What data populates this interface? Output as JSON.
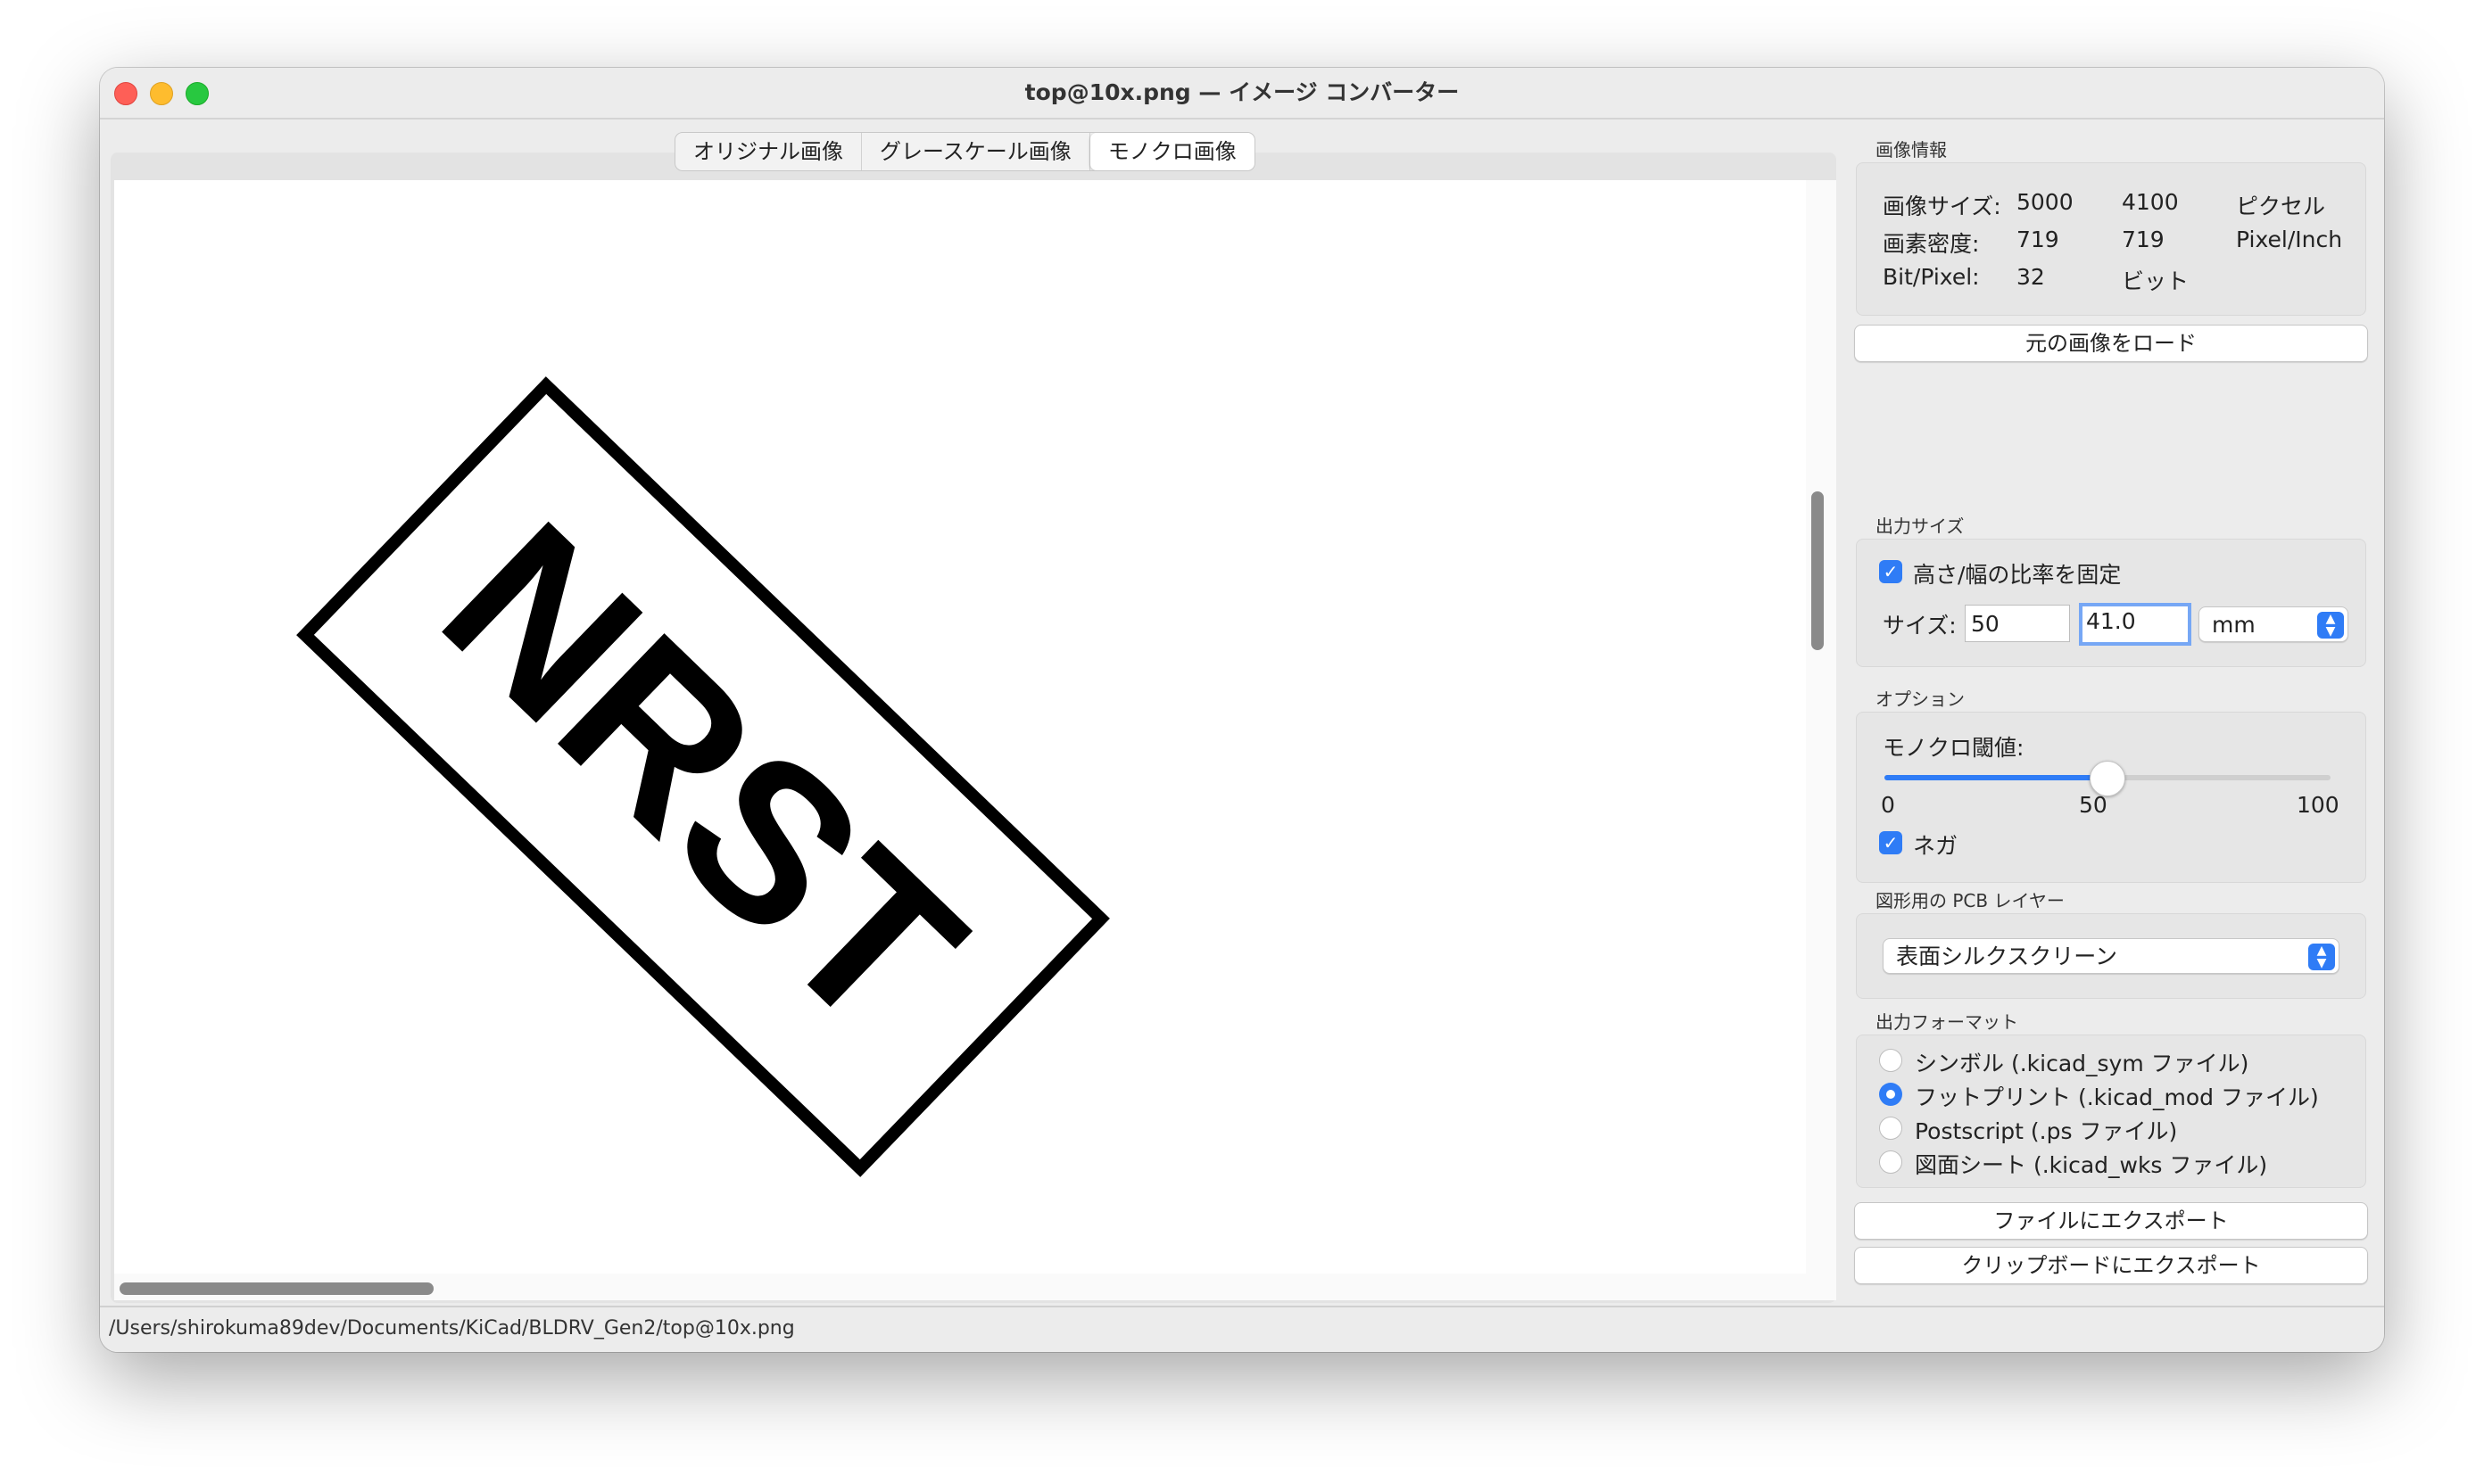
{
  "window": {
    "title": "top@10x.png — イメージ コンバーター"
  },
  "tabs": [
    {
      "label": "オリジナル画像"
    },
    {
      "label": "グレースケール画像"
    },
    {
      "label": "モノクロ画像"
    }
  ],
  "canvas": {
    "text": "NRST"
  },
  "status": {
    "path": "/Users/shirokuma89dev/Documents/KiCad/BLDRV_Gen2/top@10x.png"
  },
  "image_info": {
    "section": "画像情報",
    "rows": [
      {
        "label": "画像サイズ:",
        "v1": "5000",
        "v2": "4100",
        "unit": "ピクセル"
      },
      {
        "label": "画素密度:",
        "v1": "719",
        "v2": "719",
        "unit": "Pixel/Inch"
      },
      {
        "label": "Bit/Pixel:",
        "v1": "32",
        "v2": "ビット",
        "unit": ""
      }
    ],
    "load_button": "元の画像をロード"
  },
  "output_size": {
    "section": "出力サイズ",
    "lock_ratio_label": "高さ/幅の比率を固定",
    "size_label": "サイズ:",
    "width": "50",
    "height": "41.0",
    "unit": "mm"
  },
  "options": {
    "section": "オプション",
    "threshold_label": "モノクロ閾値:",
    "threshold_value": 50,
    "min": "0",
    "mid": "50",
    "max": "100",
    "negative_label": "ネガ"
  },
  "layer": {
    "section": "図形用の PCB レイヤー",
    "selected": "表面シルクスクリーン"
  },
  "format": {
    "section": "出力フォーマット",
    "options": [
      {
        "label": "シンボル (.kicad_sym ファイル)"
      },
      {
        "label": "フットプリント (.kicad_mod ファイル)"
      },
      {
        "label": "Postscript (.ps ファイル)"
      },
      {
        "label": "図面シート (.kicad_wks ファイル)"
      }
    ],
    "selected_index": 1
  },
  "actions": {
    "export_file": "ファイルにエクスポート",
    "export_clipboard": "クリップボードにエクスポート"
  },
  "colors": {
    "accent": "#2f7cf6"
  }
}
